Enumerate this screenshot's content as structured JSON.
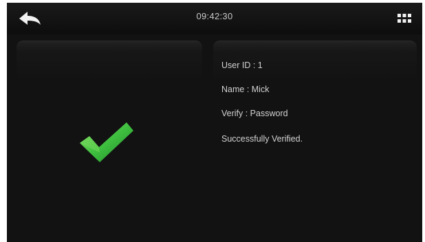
{
  "topbar": {
    "time": "09:42:30",
    "back_icon": "back-arrow-icon",
    "menu_icon": "grid-menu-icon"
  },
  "result": {
    "icon": "checkmark-icon",
    "user_id": "User ID : 1",
    "name": "Name : Mick",
    "verify": "Verify : Password",
    "status": "Successfully Verified."
  },
  "colors": {
    "background": "#121212",
    "text": "#d2d2d2",
    "check_green": "#3fbf3f"
  }
}
